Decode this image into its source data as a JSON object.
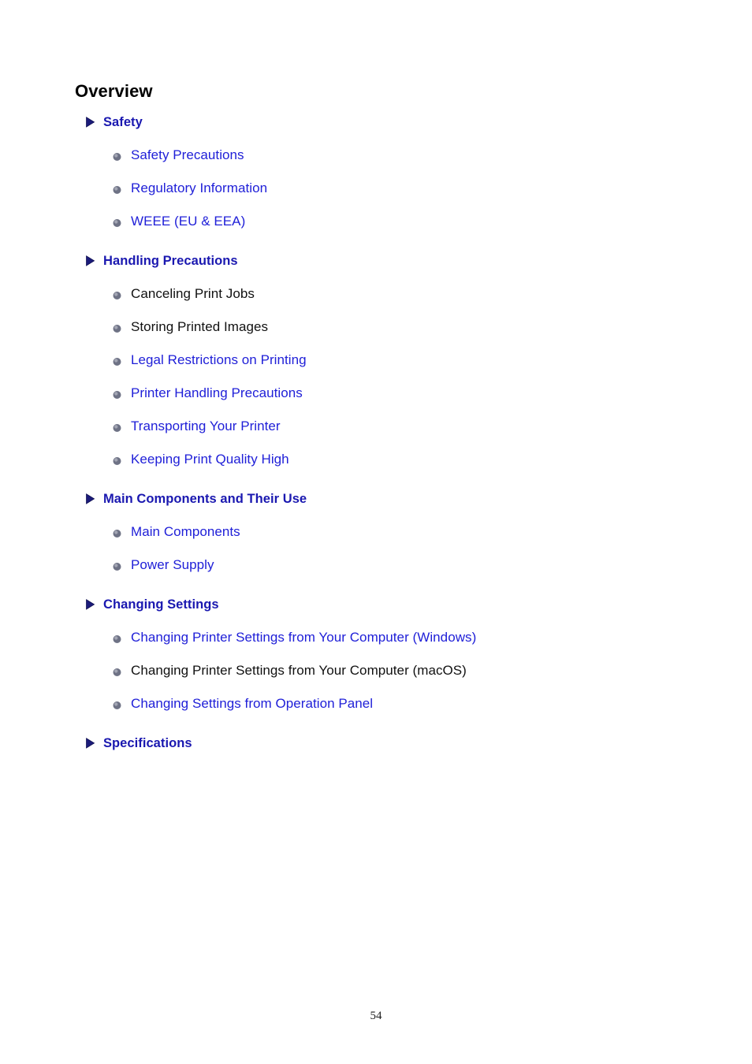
{
  "document": {
    "title": "Overview",
    "page_number": "54",
    "colors": {
      "heading_blue": "#1a18b0",
      "link_blue": "#2020d8",
      "plain_text": "#111111",
      "title_black": "#000000",
      "arrow_icon": "#1b1b7a",
      "bullet_icon": "#6e7285"
    }
  },
  "toc": {
    "sections": [
      {
        "label": "Safety",
        "icon": "arrow-right-icon",
        "items": [
          {
            "label": "Safety Precautions",
            "is_link": true,
            "icon": "sphere-bullet-icon"
          },
          {
            "label": "Regulatory Information",
            "is_link": true,
            "icon": "sphere-bullet-icon"
          },
          {
            "label": "WEEE (EU & EEA)",
            "is_link": true,
            "icon": "sphere-bullet-icon"
          }
        ]
      },
      {
        "label": "Handling Precautions",
        "icon": "arrow-right-icon",
        "items": [
          {
            "label": "Canceling Print Jobs",
            "is_link": false,
            "icon": "sphere-bullet-icon"
          },
          {
            "label": "Storing Printed Images",
            "is_link": false,
            "icon": "sphere-bullet-icon"
          },
          {
            "label": "Legal Restrictions on Printing",
            "is_link": true,
            "icon": "sphere-bullet-icon"
          },
          {
            "label": "Printer Handling Precautions",
            "is_link": true,
            "icon": "sphere-bullet-icon"
          },
          {
            "label": "Transporting Your Printer",
            "is_link": true,
            "icon": "sphere-bullet-icon"
          },
          {
            "label": "Keeping Print Quality High",
            "is_link": true,
            "icon": "sphere-bullet-icon"
          }
        ]
      },
      {
        "label": "Main Components and Their Use",
        "icon": "arrow-right-icon",
        "items": [
          {
            "label": "Main Components",
            "is_link": true,
            "icon": "sphere-bullet-icon"
          },
          {
            "label": "Power Supply",
            "is_link": true,
            "icon": "sphere-bullet-icon"
          }
        ]
      },
      {
        "label": "Changing Settings",
        "icon": "arrow-right-icon",
        "items": [
          {
            "label": "Changing Printer Settings from Your Computer (Windows)",
            "is_link": true,
            "icon": "sphere-bullet-icon"
          },
          {
            "label": "Changing Printer Settings from Your Computer (macOS)",
            "is_link": false,
            "icon": "sphere-bullet-icon"
          },
          {
            "label": "Changing Settings from Operation Panel",
            "is_link": true,
            "icon": "sphere-bullet-icon"
          }
        ]
      },
      {
        "label": "Specifications",
        "icon": "arrow-right-icon",
        "items": []
      }
    ]
  }
}
